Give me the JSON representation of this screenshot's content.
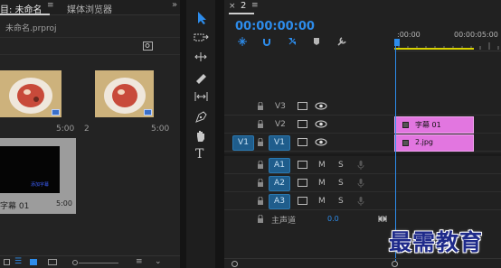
{
  "project_panel": {
    "tab_project": "目: 未命名",
    "tab_media_browser": "媒体浏览器",
    "project_file": "未命名.prproj",
    "items": [
      {
        "name": "",
        "duration": "5:00"
      },
      {
        "name": "2",
        "duration": "5:00"
      },
      {
        "name": "字幕 01",
        "duration": "5:00"
      }
    ],
    "caption_thumb_text": "添加字幕"
  },
  "timeline": {
    "tab_number": "2",
    "timecode": "00:00:00:00",
    "ruler_start": ":00:00",
    "ruler_end": "00:00:05:00",
    "tracks": {
      "v3": "V3",
      "v2": "V2",
      "v1_source": "V1",
      "v1": "V1",
      "a1": "A1",
      "a2": "A2",
      "a3": "A3",
      "mute": "M",
      "solo": "S",
      "master": "主声道",
      "master_value": "0.0"
    },
    "clips": {
      "v2": "字幕 01",
      "v1": "2.jpg"
    }
  },
  "watermark": "最需教育",
  "colors": {
    "accent_blue": "#2d8ceb",
    "clip_pink": "#e276e0",
    "track_on": "#1f5d8c"
  }
}
